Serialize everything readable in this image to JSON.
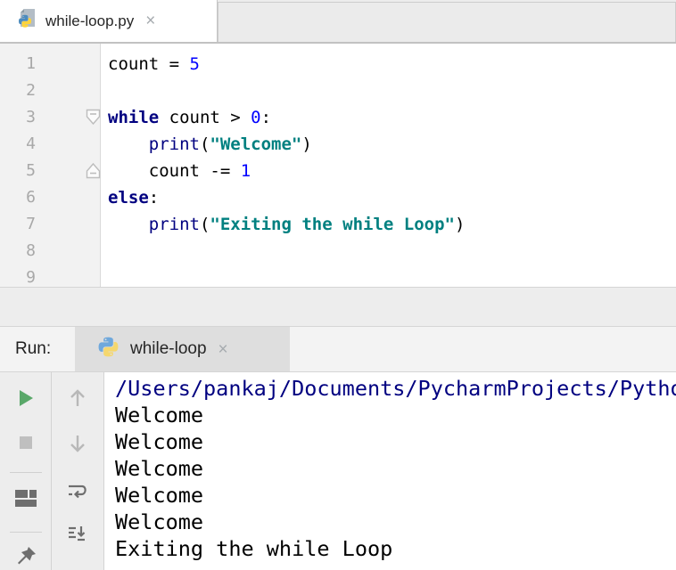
{
  "editor_tab": {
    "title": "while-loop.py",
    "close": "×"
  },
  "editor": {
    "lines": [
      {
        "num": "1",
        "tokens": [
          [
            "p",
            "count = "
          ],
          [
            "n",
            "5"
          ]
        ]
      },
      {
        "num": "2",
        "tokens": []
      },
      {
        "num": "3",
        "tokens": [
          [
            "k",
            "while"
          ],
          [
            "p",
            " count > "
          ],
          [
            "n",
            "0"
          ],
          [
            "p",
            ":"
          ]
        ]
      },
      {
        "num": "4",
        "tokens": [
          [
            "p",
            "    "
          ],
          [
            "b",
            "print"
          ],
          [
            "p",
            "("
          ],
          [
            "s",
            "\"Welcome\""
          ],
          [
            "p",
            ")"
          ]
        ]
      },
      {
        "num": "5",
        "tokens": [
          [
            "p",
            "    count -= "
          ],
          [
            "n",
            "1"
          ]
        ]
      },
      {
        "num": "6",
        "tokens": [
          [
            "k",
            "else"
          ],
          [
            "p",
            ":"
          ]
        ]
      },
      {
        "num": "7",
        "tokens": [
          [
            "p",
            "    "
          ],
          [
            "b",
            "print"
          ],
          [
            "p",
            "("
          ],
          [
            "s",
            "\"Exiting the while Loop\""
          ],
          [
            "p",
            ")"
          ]
        ]
      },
      {
        "num": "8",
        "tokens": []
      },
      {
        "num": "9",
        "tokens": []
      }
    ]
  },
  "run_panel": {
    "label": "Run:",
    "tab_title": "while-loop",
    "close": "×"
  },
  "console": {
    "lines": [
      {
        "style": "path",
        "text": "/Users/pankaj/Documents/PycharmProjects/Pytho"
      },
      {
        "style": "stdout",
        "text": "Welcome"
      },
      {
        "style": "stdout",
        "text": "Welcome"
      },
      {
        "style": "stdout",
        "text": "Welcome"
      },
      {
        "style": "stdout",
        "text": "Welcome"
      },
      {
        "style": "stdout",
        "text": "Welcome"
      },
      {
        "style": "stdout",
        "text": "Exiting the while Loop"
      }
    ]
  },
  "colors": {
    "keyword": "#000080",
    "number": "#0000FF",
    "string": "#008080",
    "console_path": "#000080",
    "play_green": "#59A869",
    "stop_gray": "#BFBFBF",
    "icon_dark": "#6E6E6E",
    "icon_disabled": "#B8B8B8"
  }
}
